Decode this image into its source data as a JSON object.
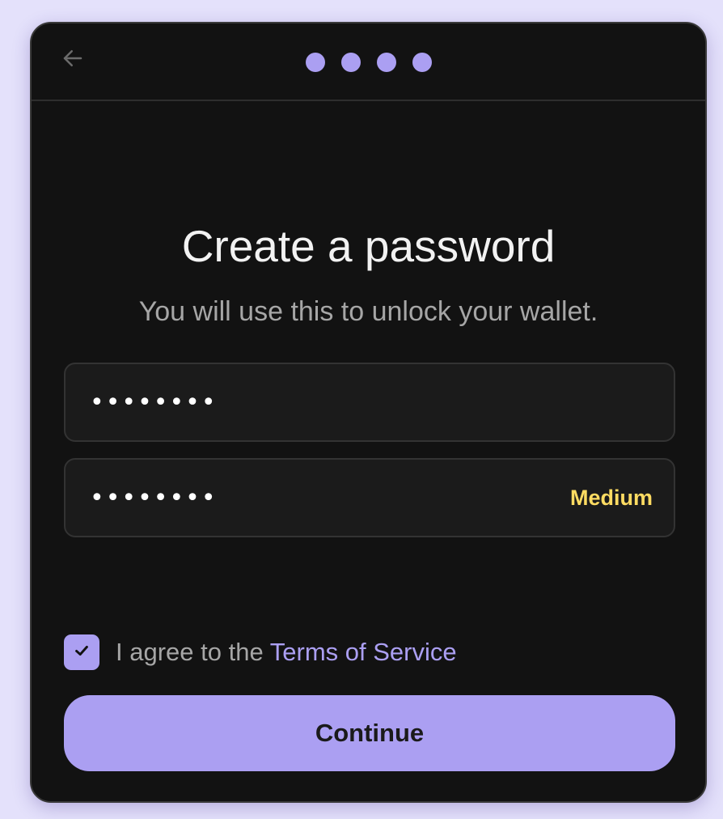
{
  "header": {
    "back_icon": "arrow-left-icon",
    "step_count": 4,
    "current_step": 4
  },
  "main": {
    "title": "Create a password",
    "subtitle": "You will use this to unlock your wallet."
  },
  "form": {
    "password_value": "••••••••",
    "confirm_value": "••••••••",
    "strength_label": "Medium"
  },
  "agreement": {
    "checked": true,
    "check_icon": "checkmark-icon",
    "prefix": "I agree to the ",
    "link_label": "Terms of Service"
  },
  "actions": {
    "continue_label": "Continue"
  },
  "colors": {
    "background": "#e4e1fb",
    "window": "#121212",
    "accent": "#ab9ff2",
    "strength_medium": "#ffdc62",
    "muted_text": "#a6a6a6"
  }
}
